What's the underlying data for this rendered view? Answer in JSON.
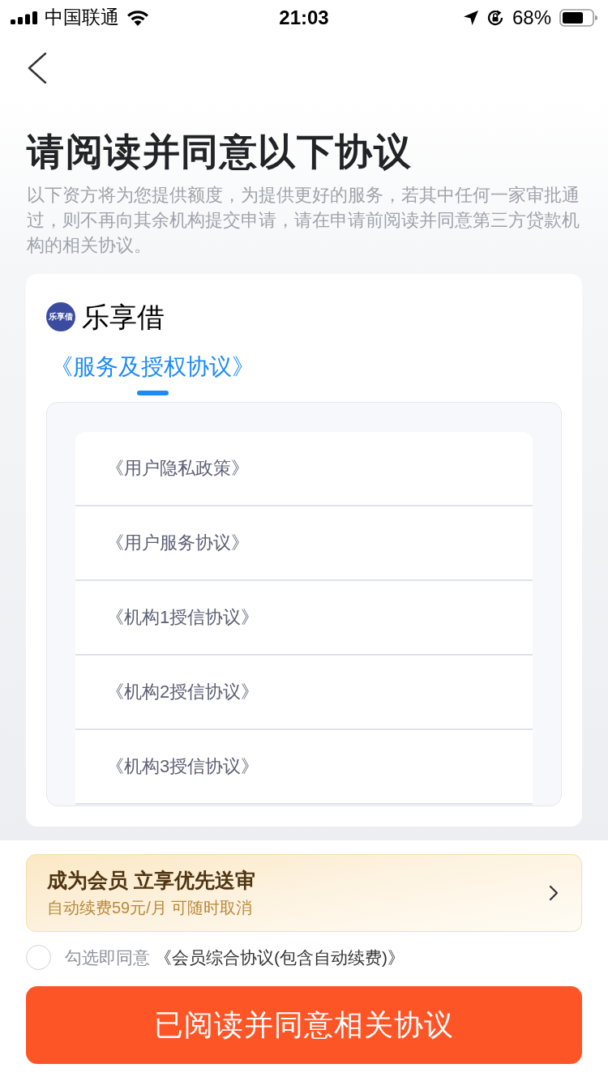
{
  "status_bar": {
    "carrier": "中国联通",
    "time": "21:03",
    "battery": "68%"
  },
  "header": {
    "title": "请阅读并同意以下协议",
    "description": "以下资方将为您提供额度，为提供更好的服务，若其中任何一家审批通过，则不再向其余机构提交申请，请在申请前阅读并同意第三方贷款机构的相关协议。"
  },
  "lender": {
    "logo_text": "乐享借",
    "name": "乐享借",
    "tabs": [
      {
        "label": "《服务及授权协议》",
        "selected": true
      }
    ],
    "documents": [
      "《用户隐私政策》",
      "《用户服务协议》",
      "《机构1授信协议》",
      "《机构2授信协议》",
      "《机构3授信协议》"
    ]
  },
  "membership": {
    "title": "成为会员 立享优先送审",
    "subtitle": "自动续费59元/月 可随时取消"
  },
  "consent": {
    "checked": false,
    "prefix": "勾选即同意",
    "link": "《会员综合协议(包含自动续费)》"
  },
  "confirm_button": "已阅读并同意相关协议"
}
